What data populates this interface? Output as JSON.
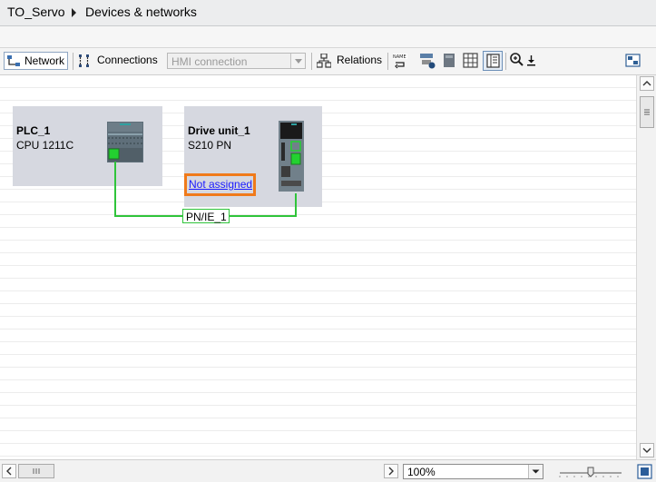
{
  "breadcrumb": {
    "project": "TO_Servo",
    "page": "Devices & networks"
  },
  "toolbar": {
    "network_label": "Network",
    "connections_label": "Connections",
    "connection_type_value": "HMI connection",
    "relations_label": "Relations"
  },
  "devices": {
    "plc": {
      "name": "PLC_1",
      "type": "CPU 1211C"
    },
    "drive": {
      "name": "Drive unit_1",
      "type": "S210 PN",
      "assignment_link": "Not assigned"
    }
  },
  "network": {
    "subnet_label": "PN/IE_1",
    "line_color": "#2fc43a"
  },
  "highlight_color": "#f07a1a",
  "link_color": "#1a1aff",
  "statusbar": {
    "zoom_value": "100%"
  }
}
